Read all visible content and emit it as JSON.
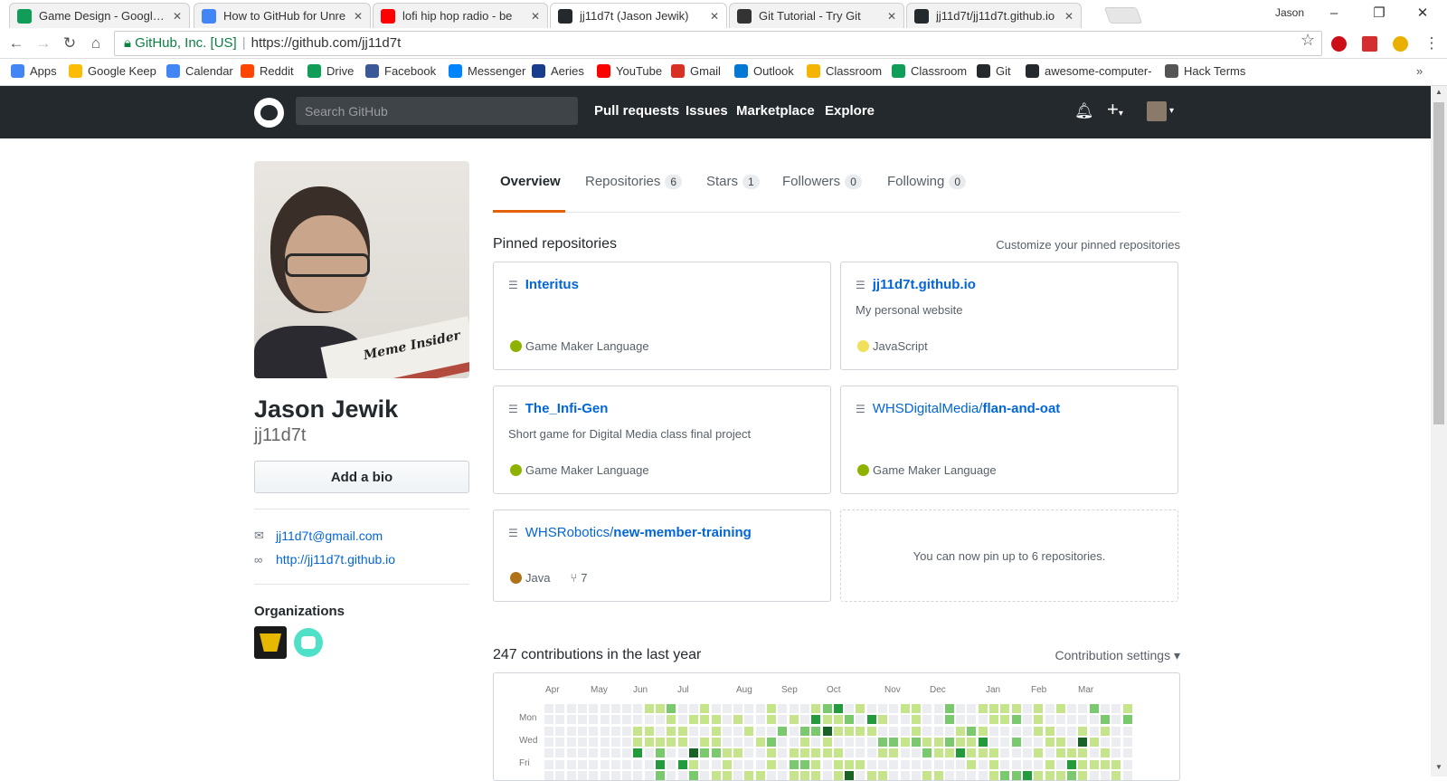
{
  "browser": {
    "tabs": [
      {
        "title": "Game Design - Google D",
        "color": "#0f9d58"
      },
      {
        "title": "How to GitHub for Unre",
        "color": "#4285f4"
      },
      {
        "title": "lofi hip hop radio - be",
        "color": "#ff0000"
      },
      {
        "title": "jj11d7t (Jason Jewik)",
        "color": "#24292e"
      },
      {
        "title": "Git Tutorial - Try Git",
        "color": "#333333"
      },
      {
        "title": "jj11d7t/jj11d7t.github.io",
        "color": "#24292e"
      }
    ],
    "profile_name": "Jason",
    "omnibox": {
      "secure_label": "GitHub, Inc. [US]",
      "url": "https://github.com/jj11d7t"
    },
    "bookmarks": [
      {
        "label": "Apps",
        "color": "#4285f4"
      },
      {
        "label": "Google Keep",
        "color": "#fbbc04"
      },
      {
        "label": "Calendar",
        "color": "#4285f4"
      },
      {
        "label": "Reddit",
        "color": "#ff4500"
      },
      {
        "label": "Drive",
        "color": "#0f9d58"
      },
      {
        "label": "Facebook",
        "color": "#3b5998"
      },
      {
        "label": "Messenger",
        "color": "#0084ff"
      },
      {
        "label": "Aeries",
        "color": "#1a3c8c"
      },
      {
        "label": "YouTube",
        "color": "#ff0000"
      },
      {
        "label": "Gmail",
        "color": "#d93025"
      },
      {
        "label": "Outlook",
        "color": "#0078d4"
      },
      {
        "label": "Classroom",
        "color": "#f4b400"
      },
      {
        "label": "Classroom",
        "color": "#0f9d58"
      },
      {
        "label": "Git",
        "color": "#24292e"
      },
      {
        "label": "awesome-computer-",
        "color": "#24292e"
      },
      {
        "label": "Hack Terms",
        "color": "#555555"
      }
    ]
  },
  "header": {
    "search_placeholder": "Search GitHub",
    "nav": [
      "Pull requests",
      "Issues",
      "Marketplace",
      "Explore"
    ]
  },
  "profile": {
    "photo_text": "Meme Insider",
    "name": "Jason Jewik",
    "username": "jj11d7t",
    "bio_button": "Add a bio",
    "email": "jj11d7t@gmail.com",
    "website": "http://jj11d7t.github.io",
    "orgs_title": "Organizations"
  },
  "tabs": [
    {
      "label": "Overview",
      "count": ""
    },
    {
      "label": "Repositories",
      "count": "6"
    },
    {
      "label": "Stars",
      "count": "1"
    },
    {
      "label": "Followers",
      "count": "0"
    },
    {
      "label": "Following",
      "count": "0"
    }
  ],
  "pinned": {
    "title": "Pinned repositories",
    "customize": "Customize your pinned repositories",
    "repos": [
      {
        "owner": "",
        "name": "Interitus",
        "desc": "",
        "lang": "Game Maker Language",
        "lang_color": "#8fb200",
        "forks": ""
      },
      {
        "owner": "",
        "name": "jj11d7t.github.io",
        "desc": "My personal website",
        "lang": "JavaScript",
        "lang_color": "#f1e05a",
        "forks": ""
      },
      {
        "owner": "",
        "name": "The_Infi-Gen",
        "desc": "Short game for Digital Media class final project",
        "lang": "Game Maker Language",
        "lang_color": "#8fb200",
        "forks": ""
      },
      {
        "owner": "WHSDigitalMedia/",
        "name": "flan-and-oat",
        "desc": "",
        "lang": "Game Maker Language",
        "lang_color": "#8fb200",
        "forks": ""
      },
      {
        "owner": "WHSRobotics/",
        "name": "new-member-training",
        "desc": "",
        "lang": "Java",
        "lang_color": "#b07219",
        "forks": "7"
      }
    ],
    "pin_note": "You can now pin up to 6 repositories."
  },
  "contributions": {
    "title": "247 contributions in the last year",
    "settings": "Contribution settings ▾",
    "months": [
      "Apr",
      "May",
      "Jun",
      "Jul",
      "Aug",
      "Sep",
      "Oct",
      "Nov",
      "Dec",
      "Jan",
      "Feb",
      "Mar"
    ],
    "days": [
      "Mon",
      "Wed",
      "Fri"
    ],
    "colors": [
      "#ebedf0",
      "#c6e48b",
      "#7bc96f",
      "#239a3b",
      "#196127"
    ]
  }
}
